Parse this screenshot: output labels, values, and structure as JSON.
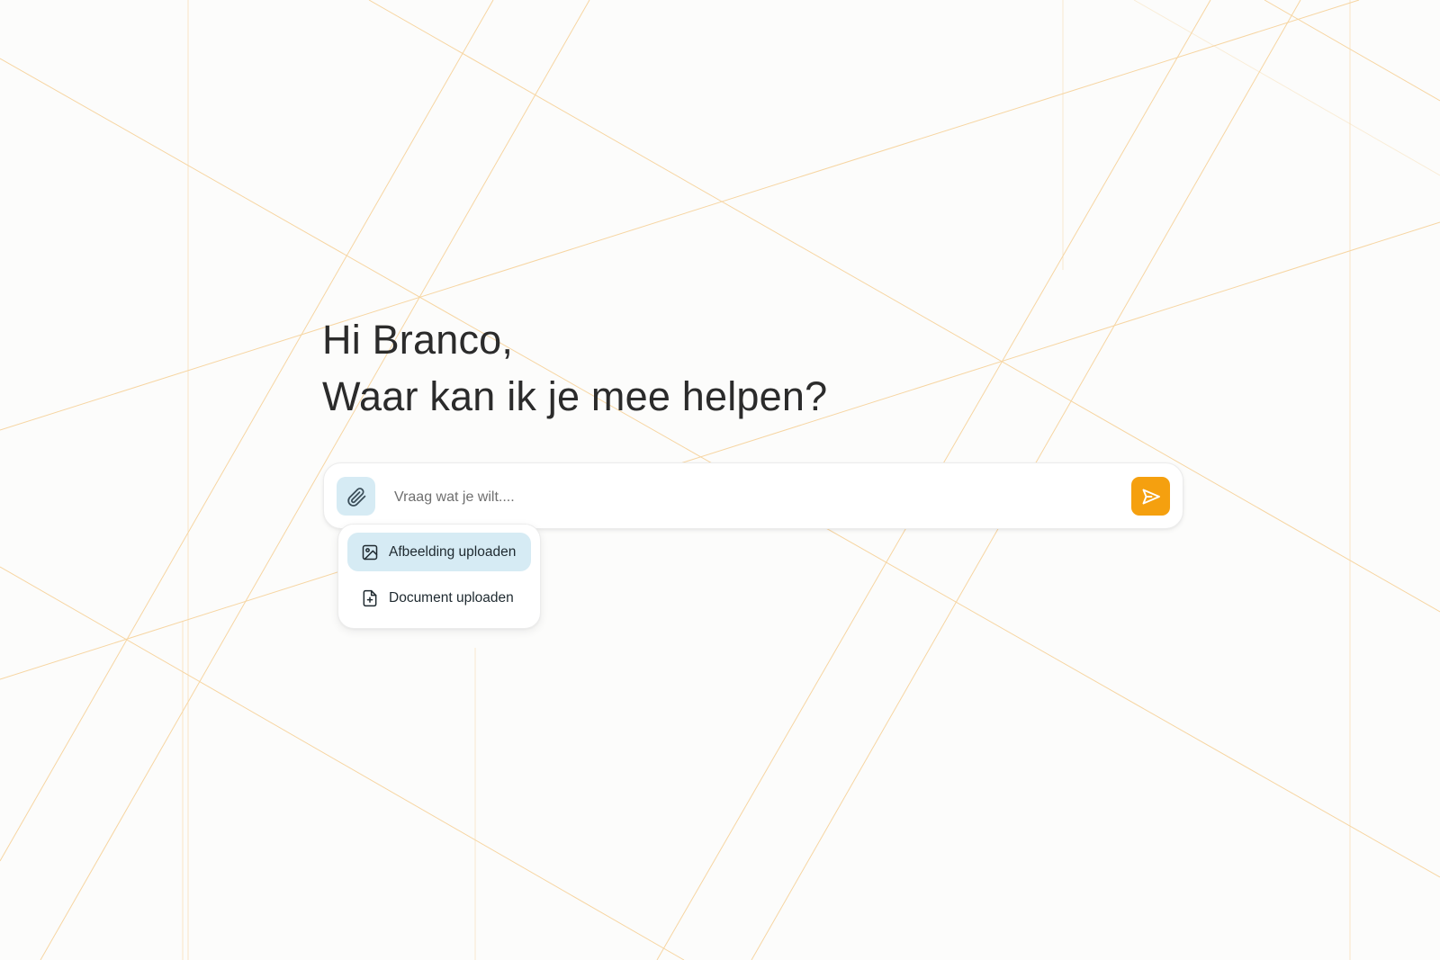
{
  "greeting": {
    "line1": "Hi Branco,",
    "line2": "Waar kan ik je mee helpen?"
  },
  "chat": {
    "placeholder": "Vraag wat je wilt....",
    "attach_icon": "paperclip-icon",
    "send_icon": "send-icon"
  },
  "upload_menu": {
    "items": [
      {
        "label": "Afbeelding uploaden",
        "icon": "image-icon",
        "active": true
      },
      {
        "label": "Document uploaden",
        "icon": "file-plus-icon",
        "active": false
      }
    ]
  },
  "colors": {
    "accent": "#f5a00f",
    "highlight": "#d6ebf4",
    "text": "#2b2b2b",
    "background": "#fcfcfb",
    "line": "#f6cf93"
  }
}
